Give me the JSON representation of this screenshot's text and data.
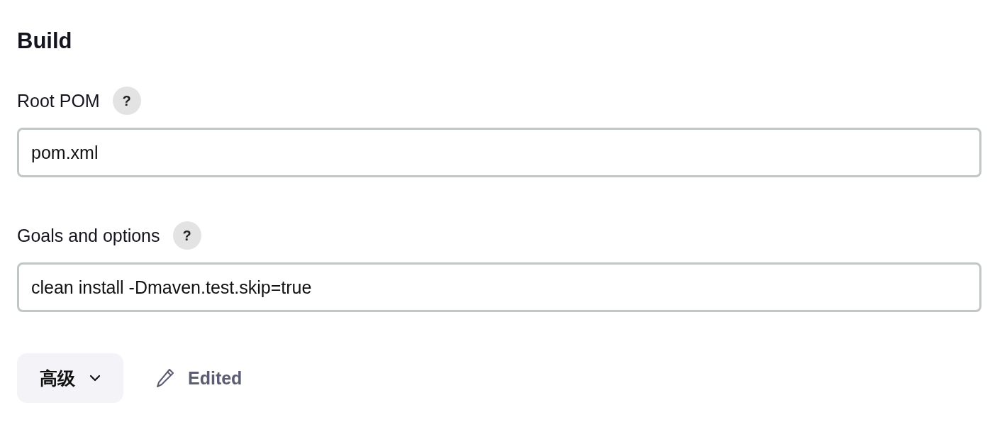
{
  "section": {
    "title": "Build"
  },
  "fields": [
    {
      "label": "Root POM",
      "help": "?",
      "value": "pom.xml"
    },
    {
      "label": "Goals and options",
      "help": "?",
      "value": "clean install -Dmaven.test.skip=true"
    }
  ],
  "advanced_button": {
    "label": "高级"
  },
  "status": {
    "text": "Edited"
  }
}
